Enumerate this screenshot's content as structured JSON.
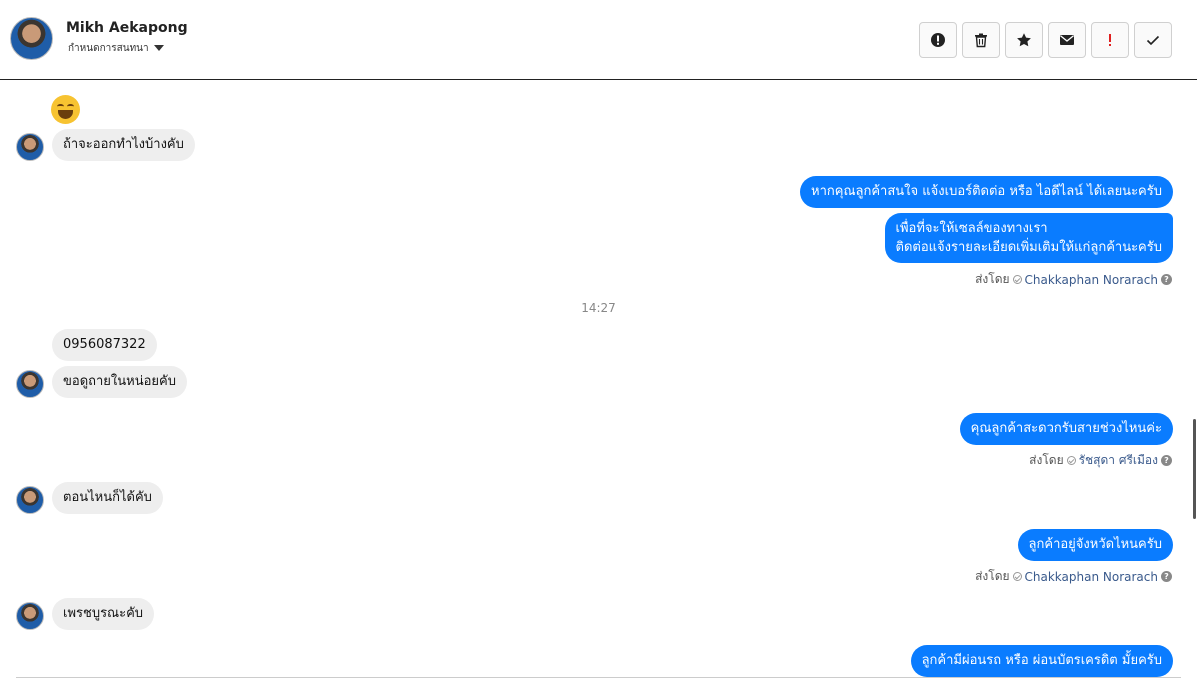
{
  "contact": {
    "name": "Mikh Aekapong",
    "subtitle": "กำหนดการสนทนา"
  },
  "actions": [
    {
      "name": "alert-button",
      "icon": "alert-circle-icon"
    },
    {
      "name": "delete-button",
      "icon": "trash-icon"
    },
    {
      "name": "star-button",
      "icon": "star-icon"
    },
    {
      "name": "mail-button",
      "icon": "envelope-icon"
    },
    {
      "name": "important-button",
      "icon": "exclamation-icon"
    },
    {
      "name": "done-button",
      "icon": "check-icon"
    }
  ],
  "messages": {
    "m1": "ถ้าจะออกทำไงบ้างคับ",
    "m2": "หากคุณลูกค้าสนใจ แจ้งเบอร์ติดต่อ หรือ ไอดีไลน์ ได้เลยนะครับ",
    "m3_line1": "เพื่อที่จะให้เซลล์ของทางเรา",
    "m3_line2": "ติดต่อแจ้งรายละเอียดเพิ่มเติมให้แก่ลูกค้านะครับ",
    "m4": "0956087322",
    "m5": "ขอดูถายในหน่อยคับ",
    "m6": "คุณลูกค้าสะดวกรับสายช่วงไหนค่ะ",
    "m7": "ตอนไหนก็ได้คับ",
    "m8": "ลูกค้าอยู่จังหวัดไหนครับ",
    "m9": "เพรชบูรณะคับ",
    "m10": "ลูกค้ามีผ่อนรถ หรือ ผ่อนบัตรเครดิต มั้ยครับ"
  },
  "sent_by_label": "ส่งโดย",
  "agents": {
    "a1": "Chakkaphan Norarach",
    "a2": "รัชสุดา ศรีเมือง"
  },
  "timestamp": "14:27",
  "colors": {
    "outgoing": "#0a7cff",
    "incoming": "#eeeeee",
    "important": "#e02020"
  }
}
